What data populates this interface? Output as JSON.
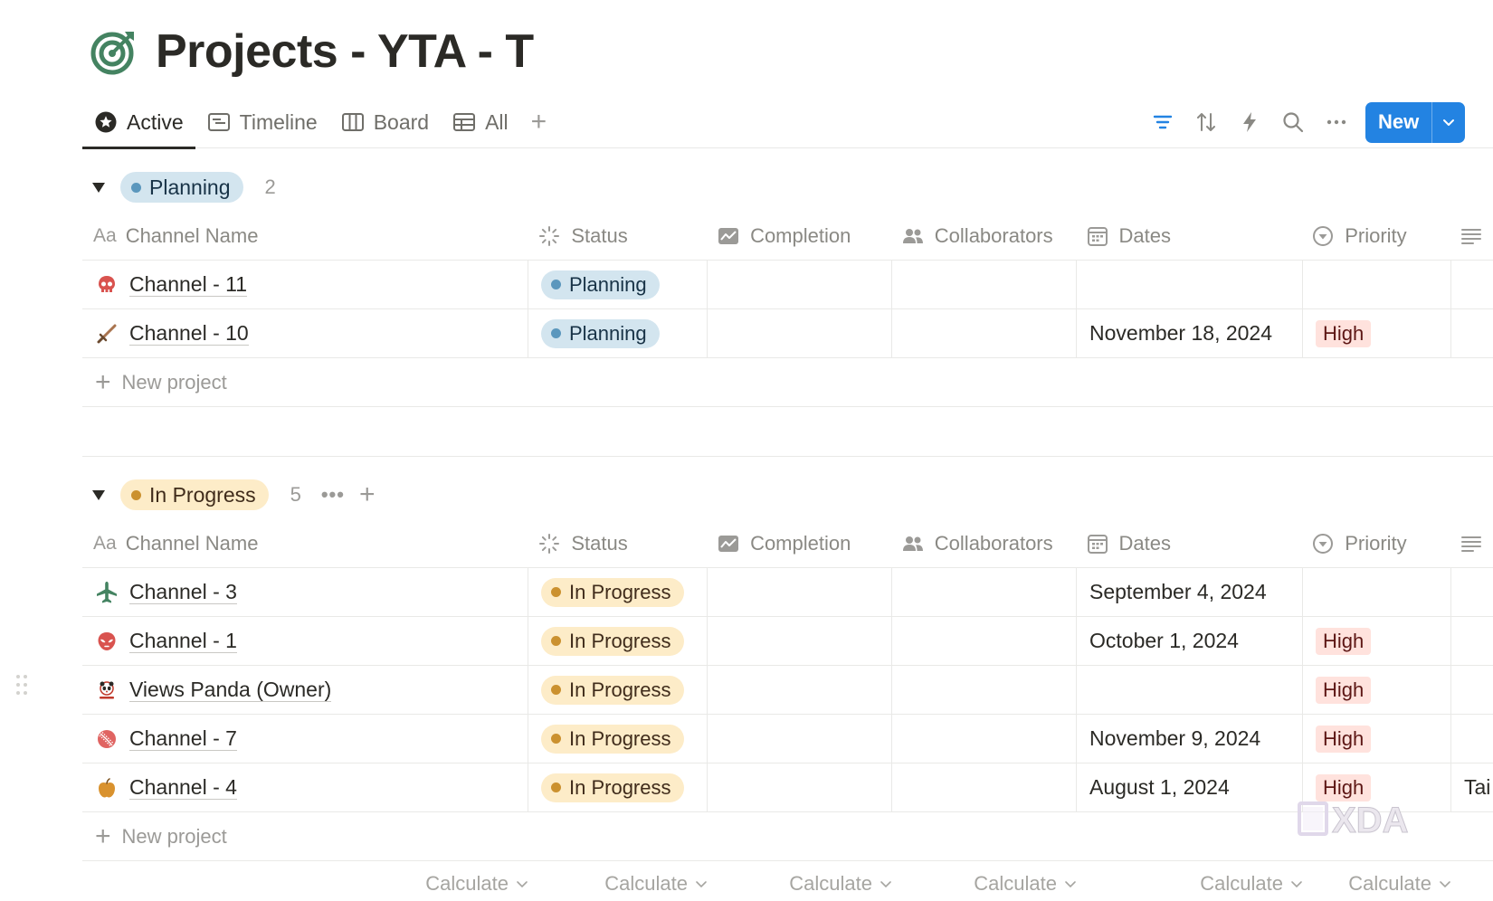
{
  "page": {
    "title": "Projects - YTA - T",
    "title_icon": "target-icon"
  },
  "tabs": [
    {
      "label": "Active",
      "icon": "star-circle-icon",
      "active": true
    },
    {
      "label": "Timeline",
      "icon": "timeline-icon"
    },
    {
      "label": "Board",
      "icon": "board-icon"
    },
    {
      "label": "All",
      "icon": "table-icon"
    }
  ],
  "toolbar": {
    "tab_add": "+",
    "filter": "filter-icon",
    "sort": "sort-icon",
    "automation": "lightning-icon",
    "search": "search-icon",
    "more": "more-icon",
    "new_label": "New"
  },
  "columns": {
    "name_prefix": "Aa",
    "name": "Channel Name",
    "status": "Status",
    "completion": "Completion",
    "collaborators": "Collaborators",
    "dates": "Dates",
    "priority": "Priority"
  },
  "groups": [
    {
      "label": "Planning",
      "count": "2",
      "rows": [
        {
          "name": "Channel - 11",
          "icon": "skull-icon",
          "status": "Planning",
          "dates": "",
          "priority": ""
        },
        {
          "name": "Channel - 10",
          "icon": "sword-icon",
          "status": "Planning",
          "dates": "November 18, 2024",
          "priority": "High"
        }
      ],
      "new_label": "New project"
    },
    {
      "label": "In Progress",
      "count": "5",
      "more": "•••",
      "add": "+",
      "rows": [
        {
          "name": "Channel - 3",
          "icon": "airplane-icon",
          "status": "In Progress",
          "dates": "September 4, 2024",
          "priority": "",
          "extra": ""
        },
        {
          "name": "Channel - 1",
          "icon": "alien-icon",
          "status": "In Progress",
          "dates": "October 1, 2024",
          "priority": "High",
          "extra": ""
        },
        {
          "name": "Views Panda (Owner)",
          "icon": "panda-logo-icon",
          "status": "In Progress",
          "dates": "",
          "priority": "High",
          "extra": ""
        },
        {
          "name": "Channel - 7",
          "icon": "cricket-ball-icon",
          "status": "In Progress",
          "dates": "November 9, 2024",
          "priority": "High",
          "extra": ""
        },
        {
          "name": "Channel - 4",
          "icon": "apple-icon",
          "status": "In Progress",
          "dates": "August 1, 2024",
          "priority": "High",
          "extra": "Tai"
        }
      ],
      "new_label": "New project"
    }
  ],
  "calculate": [
    "Calculate",
    "Calculate",
    "Calculate",
    "Calculate",
    "Calculate",
    "Calculate"
  ],
  "watermark": "XDA",
  "colors": {
    "accent": "#2383e2",
    "planning_bg": "#d3e5ef",
    "planning_dot": "#5b97bd",
    "progress_bg": "#fdecc8",
    "progress_dot": "#cb912f",
    "high_bg": "#ffe2dd",
    "target_green": "#448361"
  }
}
